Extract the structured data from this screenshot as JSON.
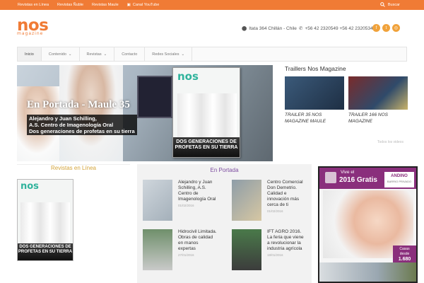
{
  "topbar": {
    "links": [
      "Revistas en Línea",
      "Revistas Ñuble",
      "Revistas Maule",
      "Canal YouTube"
    ],
    "search_label": "Buscar"
  },
  "header": {
    "logo_text": "nos",
    "logo_sub": "magazine",
    "address": "Itata 364 Chillán - Chile",
    "phone": "+56 42 2320549 +56 42 2320534",
    "social_icons": [
      "facebook-icon",
      "twitter-icon",
      "instagram-icon"
    ]
  },
  "nav": {
    "items": [
      "Inicio",
      "Contenido",
      "Revistas",
      "Contacto",
      "Redes Sociales"
    ]
  },
  "hero": {
    "title": "En Portada - Maule 35",
    "caption": [
      "Alejandro y Juan Schilling,",
      "A.S. Centro de Imagenología Oral",
      "Dos generaciones de profetas en su tierra"
    ],
    "cover_logo": "nos",
    "cover_text": "DOS GENERACIONES DE PROFETAS EN SU TIERRA"
  },
  "trailers": {
    "heading": "Traillers Nos Magazine",
    "items": [
      {
        "title": "TRAILER 35 NOS MAGAZINE MAULE"
      },
      {
        "title": "TRAILER 166 NOS MAGAZINE"
      }
    ],
    "all_videos": "Todos los videos"
  },
  "revistas": {
    "heading": "Revistas en Línea",
    "cover_logo": "nos",
    "cover_text": "DOS GENERACIONES DE PROFETAS EN SU TIERRA"
  },
  "portada": {
    "heading": "En Portada",
    "items": [
      {
        "title": "Alejandro y Juan Schilling, A.S. Centro de Imagenología Oral",
        "date": "01/02/2016"
      },
      {
        "title": "Centro Comercial Don Demetrio. Calidad e innovación más cerca de ti",
        "date": "01/02/2016"
      },
      {
        "title": "Hidrocivil Limitada. Obras de calidad en manos expertas",
        "date": "27/01/2016"
      },
      {
        "title": "IFT AGRO 2016. La feria que viene a revolucionar la industria agrícola",
        "date": "18/01/2016"
      }
    ]
  },
  "ad": {
    "vive": "Vive el",
    "gratis": "2016 Gratis",
    "brand": "ANDINO",
    "brand_sub": "BARRIO PRIVADO",
    "price_label": "Casas desde",
    "price": "1.680"
  },
  "colors": {
    "accent": "#f07b35",
    "revistas_heading": "#d4a43b",
    "portada_heading": "#7d4ca0",
    "ad_purple": "#8a2f7c"
  }
}
